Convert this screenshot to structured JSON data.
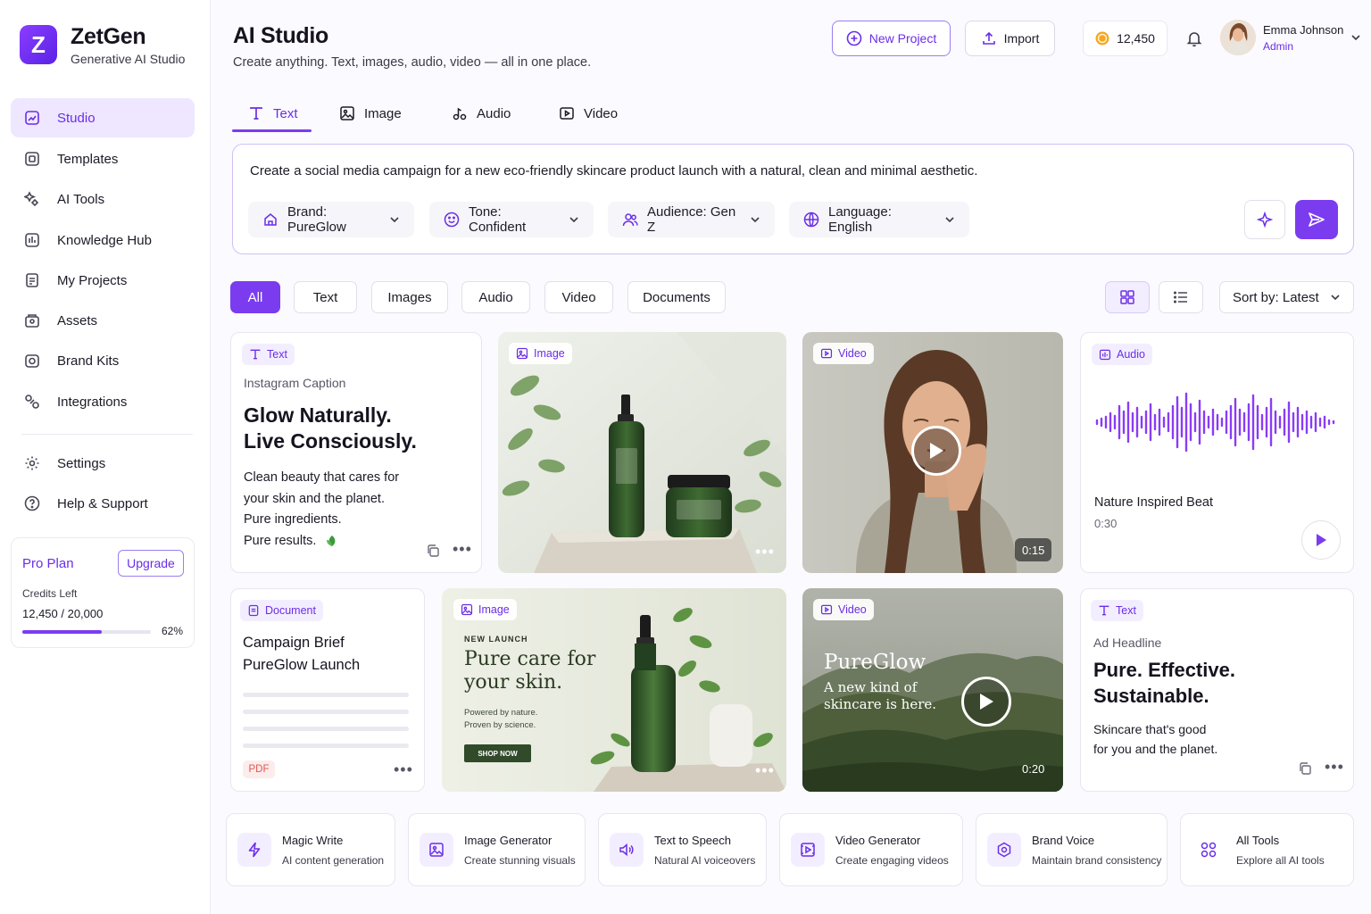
{
  "app": {
    "name": "ZetGen",
    "subtitle": "Generative AI Studio",
    "logo_letter": "Z",
    "accent": "#7B3CF0"
  },
  "sidebar": {
    "items": [
      {
        "label": "Studio",
        "icon": "studio-icon",
        "active": true
      },
      {
        "label": "Templates",
        "icon": "templates-icon"
      },
      {
        "label": "AI Tools",
        "icon": "ai-tools-icon"
      },
      {
        "label": "Knowledge Hub",
        "icon": "knowledge-hub-icon"
      },
      {
        "label": "My Projects",
        "icon": "projects-icon"
      },
      {
        "label": "Assets",
        "icon": "assets-icon"
      },
      {
        "label": "Brand Kits",
        "icon": "brand-kits-icon"
      },
      {
        "label": "Integrations",
        "icon": "integrations-icon"
      }
    ],
    "bottom_items": [
      {
        "label": "Settings",
        "icon": "gear-icon"
      },
      {
        "label": "Help & Support",
        "icon": "help-icon"
      }
    ],
    "plan": {
      "name": "Pro Plan",
      "upgrade_label": "Upgrade",
      "credits_label": "Credits Left",
      "credits_value": "12,450 / 20,000",
      "percent_label": "62%",
      "progress": 0.62
    }
  },
  "header": {
    "title": "AI Studio",
    "subtitle": "Create anything. Text, images, audio, video — all in one place.",
    "new_project_label": "New Project",
    "import_label": "Import",
    "credits": "12,450",
    "user": {
      "name": "Emma Johnson",
      "role": "Admin"
    }
  },
  "tabs": [
    {
      "label": "Text",
      "icon": "text-icon",
      "active": true
    },
    {
      "label": "Image",
      "icon": "image-icon"
    },
    {
      "label": "Audio",
      "icon": "audio-icon"
    },
    {
      "label": "Video",
      "icon": "video-icon"
    }
  ],
  "prompt": {
    "text": "Create a social media campaign for a new eco-friendly skincare product launch with a natural, clean and minimal aesthetic.",
    "chips": [
      {
        "label": "Brand: PureGlow",
        "icon": "brand-icon"
      },
      {
        "label": "Tone: Confident",
        "icon": "smile-icon"
      },
      {
        "label": "Audience: Gen Z",
        "icon": "users-icon"
      },
      {
        "label": "Language: English",
        "icon": "globe-icon"
      }
    ]
  },
  "filters": [
    "All",
    "Text",
    "Images",
    "Audio",
    "Video",
    "Documents"
  ],
  "sort_label": "Sort by: Latest",
  "cards": {
    "text1": {
      "badge": "Text",
      "kicker": "Instagram Caption",
      "headline1": "Glow Naturally.",
      "headline2": "Live Consciously.",
      "body": [
        "Clean beauty that cares for",
        "your skin and the planet.",
        "Pure ingredients.",
        "Pure results."
      ]
    },
    "image1": {
      "badge": "Image"
    },
    "video1": {
      "badge": "Video",
      "duration": "0:15"
    },
    "audio1": {
      "badge": "Audio",
      "title": "Nature Inspired Beat",
      "duration": "0:30"
    },
    "doc1": {
      "badge": "Document",
      "title1": "Campaign Brief",
      "title2": "PureGlow Launch",
      "file_type": "PDF"
    },
    "image2": {
      "badge": "Image",
      "eyebrow": "NEW LAUNCH",
      "headline1": "Pure care for",
      "headline2": "your skin.",
      "tag1": "Powered by nature.",
      "tag2": "Proven by science.",
      "cta": "SHOP NOW"
    },
    "video2": {
      "badge": "Video",
      "title": "PureGlow",
      "line1": "A new kind of",
      "line2": "skincare is here.",
      "duration": "0:20"
    },
    "text2": {
      "badge": "Text",
      "kicker": "Ad Headline",
      "headline1": "Pure. Effective.",
      "headline2": "Sustainable.",
      "body": [
        "Skincare that's good",
        "for you and the planet."
      ]
    }
  },
  "tools": [
    {
      "title": "Magic Write",
      "desc": "AI content generation",
      "icon": "lightning-icon"
    },
    {
      "title": "Image Generator",
      "desc": "Create stunning visuals",
      "icon": "image-icon"
    },
    {
      "title": "Text to Speech",
      "desc": "Natural AI voiceovers",
      "icon": "speaker-icon"
    },
    {
      "title": "Video Generator",
      "desc": "Create engaging videos",
      "icon": "video-icon"
    },
    {
      "title": "Brand Voice",
      "desc": "Maintain brand consistency",
      "icon": "brand-voice-icon"
    },
    {
      "title": "All Tools",
      "desc": "Explore all AI tools",
      "icon": "grid-icon"
    }
  ]
}
